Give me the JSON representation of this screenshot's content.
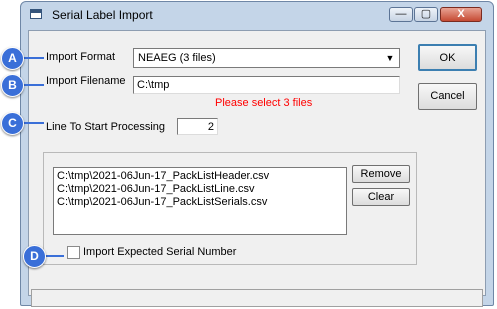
{
  "window": {
    "title": "Serial Label Import",
    "controls": {
      "minimize": "—",
      "maximize": "▢",
      "close": "X"
    }
  },
  "form": {
    "import_format_label": "Import Format",
    "import_format_value": "NEAEG (3 files)",
    "import_filename_label": "Import Filename",
    "import_filename_value": "C:\\tmp",
    "validation_message": "Please select 3 files",
    "line_start_label": "Line To Start Processing",
    "line_start_value": "2"
  },
  "buttons": {
    "ok": "OK",
    "cancel": "Cancel",
    "remove": "Remove",
    "clear": "Clear"
  },
  "file_list": [
    "C:\\tmp\\2021-06Jun-17_PackListHeader.csv",
    "C:\\tmp\\2021-06Jun-17_PackListLine.csv",
    "C:\\tmp\\2021-06Jun-17_PackListSerials.csv"
  ],
  "checkbox": {
    "label": "Import Expected Serial Number",
    "checked": false
  },
  "callouts": [
    "A",
    "B",
    "C",
    "D"
  ],
  "colors": {
    "callout": "#3a6fd8",
    "error_text": "#ff0000",
    "window_frame": "#c4d5e8",
    "client_bg": "#f0f0f0"
  }
}
